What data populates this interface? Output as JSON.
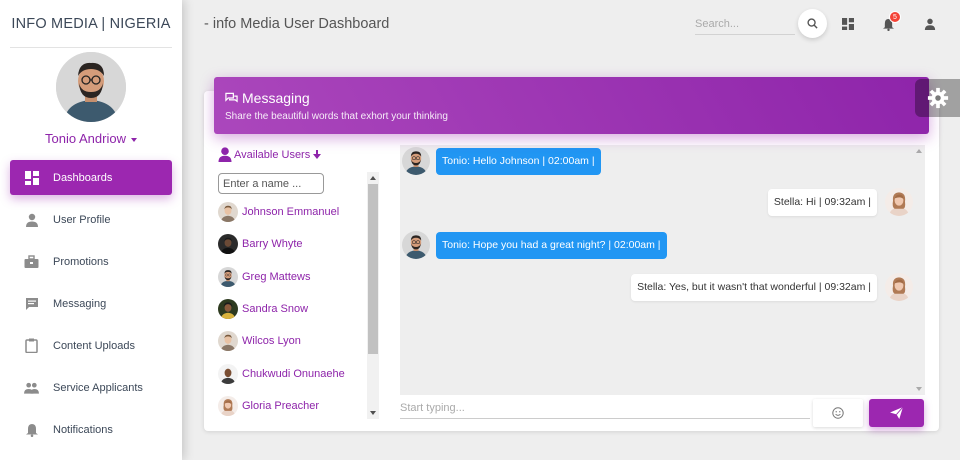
{
  "brand": "INFO MEDIA | NIGERIA",
  "page_title": "- info Media User Dashboard",
  "profile": {
    "name": "Tonio Andriow"
  },
  "sidebar": {
    "items": [
      {
        "label": "Dashboards",
        "icon": "dashboard-icon",
        "active": true
      },
      {
        "label": "User Profile",
        "icon": "person-icon"
      },
      {
        "label": "Promotions",
        "icon": "briefcase-icon"
      },
      {
        "label": "Messaging",
        "icon": "chat-icon"
      },
      {
        "label": "Content Uploads",
        "icon": "clipboard-icon"
      },
      {
        "label": "Service Applicants",
        "icon": "people-icon"
      },
      {
        "label": "Notifications",
        "icon": "bell-icon"
      }
    ]
  },
  "topbar": {
    "search_placeholder": "Search...",
    "notification_count": "5"
  },
  "messaging": {
    "title": "Messaging",
    "subtitle": "Share the beautiful words that exhort your thinking"
  },
  "users_panel": {
    "heading": "Available Users",
    "search_placeholder": "Enter a name ...",
    "users": [
      "Johnson Emmanuel",
      "Barry Whyte",
      "Greg Mattews",
      "Sandra Snow",
      "Wilcos Lyon",
      "Chukwudi Onunaehe",
      "Gloria Preacher"
    ]
  },
  "chat": {
    "messages": [
      {
        "from": "in",
        "text": "Tonio: Hello Johnson | 02:00am |"
      },
      {
        "from": "out",
        "text": "Stella: Hi | 09:32am |"
      },
      {
        "from": "in",
        "text": "Tonio: Hope you had a great night? | 02:00am |"
      },
      {
        "from": "out",
        "text": "Stella: Yes, but it wasn't that wonderful | 09:32am |"
      }
    ],
    "input_placeholder": "Start typing..."
  },
  "colors": {
    "accent": "#9c27b0",
    "bubble_in": "#2196f3",
    "badge": "#f44336"
  }
}
